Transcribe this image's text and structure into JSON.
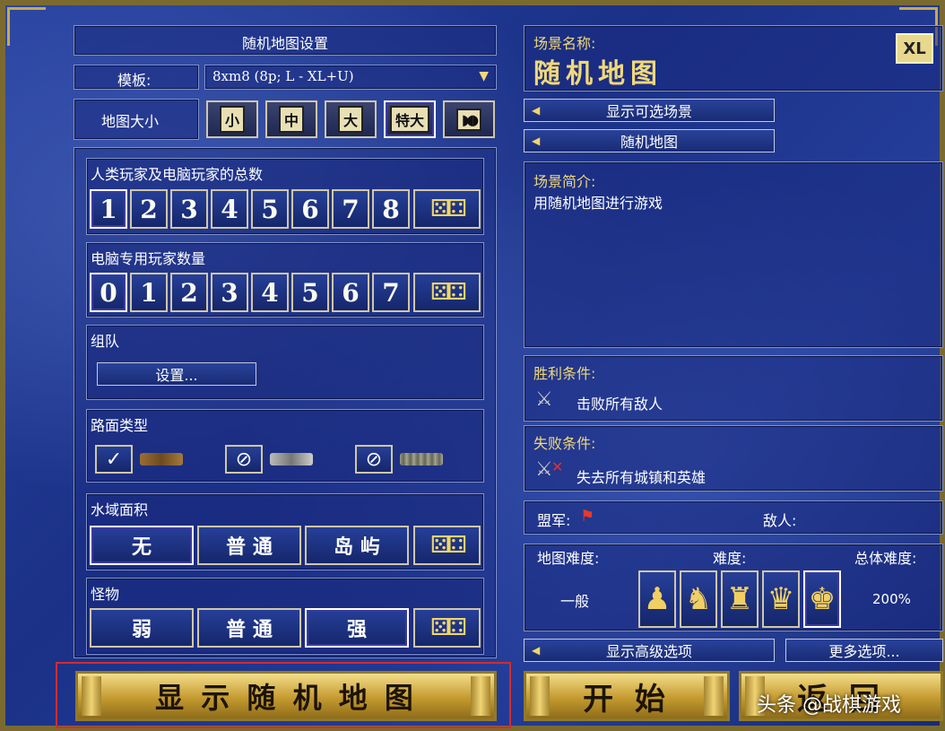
{
  "left": {
    "title": "随机地图设置",
    "template_label": "模板:",
    "template_value": "8xm8 (8p; L - XL+U)",
    "map_size_label": "地图大小",
    "map_sizes": [
      "小",
      "中",
      "大",
      "特大"
    ],
    "players_total_label": "人类玩家及电脑玩家的总数",
    "players_total_options": [
      "1",
      "2",
      "3",
      "4",
      "5",
      "6",
      "7",
      "8"
    ],
    "computer_players_label": "电脑专用玩家数量",
    "computer_players_options": [
      "0",
      "1",
      "2",
      "3",
      "4",
      "5",
      "6",
      "7"
    ],
    "teams_label": "组队",
    "teams_button": "设置...",
    "road_label": "路面类型",
    "water_label": "水域面积",
    "water_options": [
      "无",
      "普 通",
      "岛 屿"
    ],
    "monster_label": "怪物",
    "monster_options": [
      "弱",
      "普 通",
      "强"
    ],
    "show_map_button": "显 示 随 机 地 图"
  },
  "right": {
    "scenario_name_label": "场景名称:",
    "scenario_name": "随机地图",
    "size_badge": "XL",
    "show_scenarios_button": "显示可选场景",
    "random_map_button": "随机地图",
    "description_label": "场景简介:",
    "description": "用随机地图进行游戏",
    "victory_label": "胜利条件:",
    "victory_text": "击败所有敌人",
    "loss_label": "失败条件:",
    "loss_text": "失去所有城镇和英雄",
    "allies_label": "盟军:",
    "enemies_label": "敌人:",
    "map_difficulty_label": "地图难度:",
    "difficulty_label": "难度:",
    "overall_difficulty_label": "总体难度:",
    "map_difficulty_value": "一般",
    "overall_difficulty_value": "200%",
    "advanced_options_button": "显示高级选项",
    "more_options_button": "更多选项...",
    "start_button": "开 始",
    "back_button": "返 回"
  },
  "watermark": "头条 @战棋游戏",
  "colors": {
    "gold": "#f2d878",
    "highlight_box": "#d23030"
  }
}
